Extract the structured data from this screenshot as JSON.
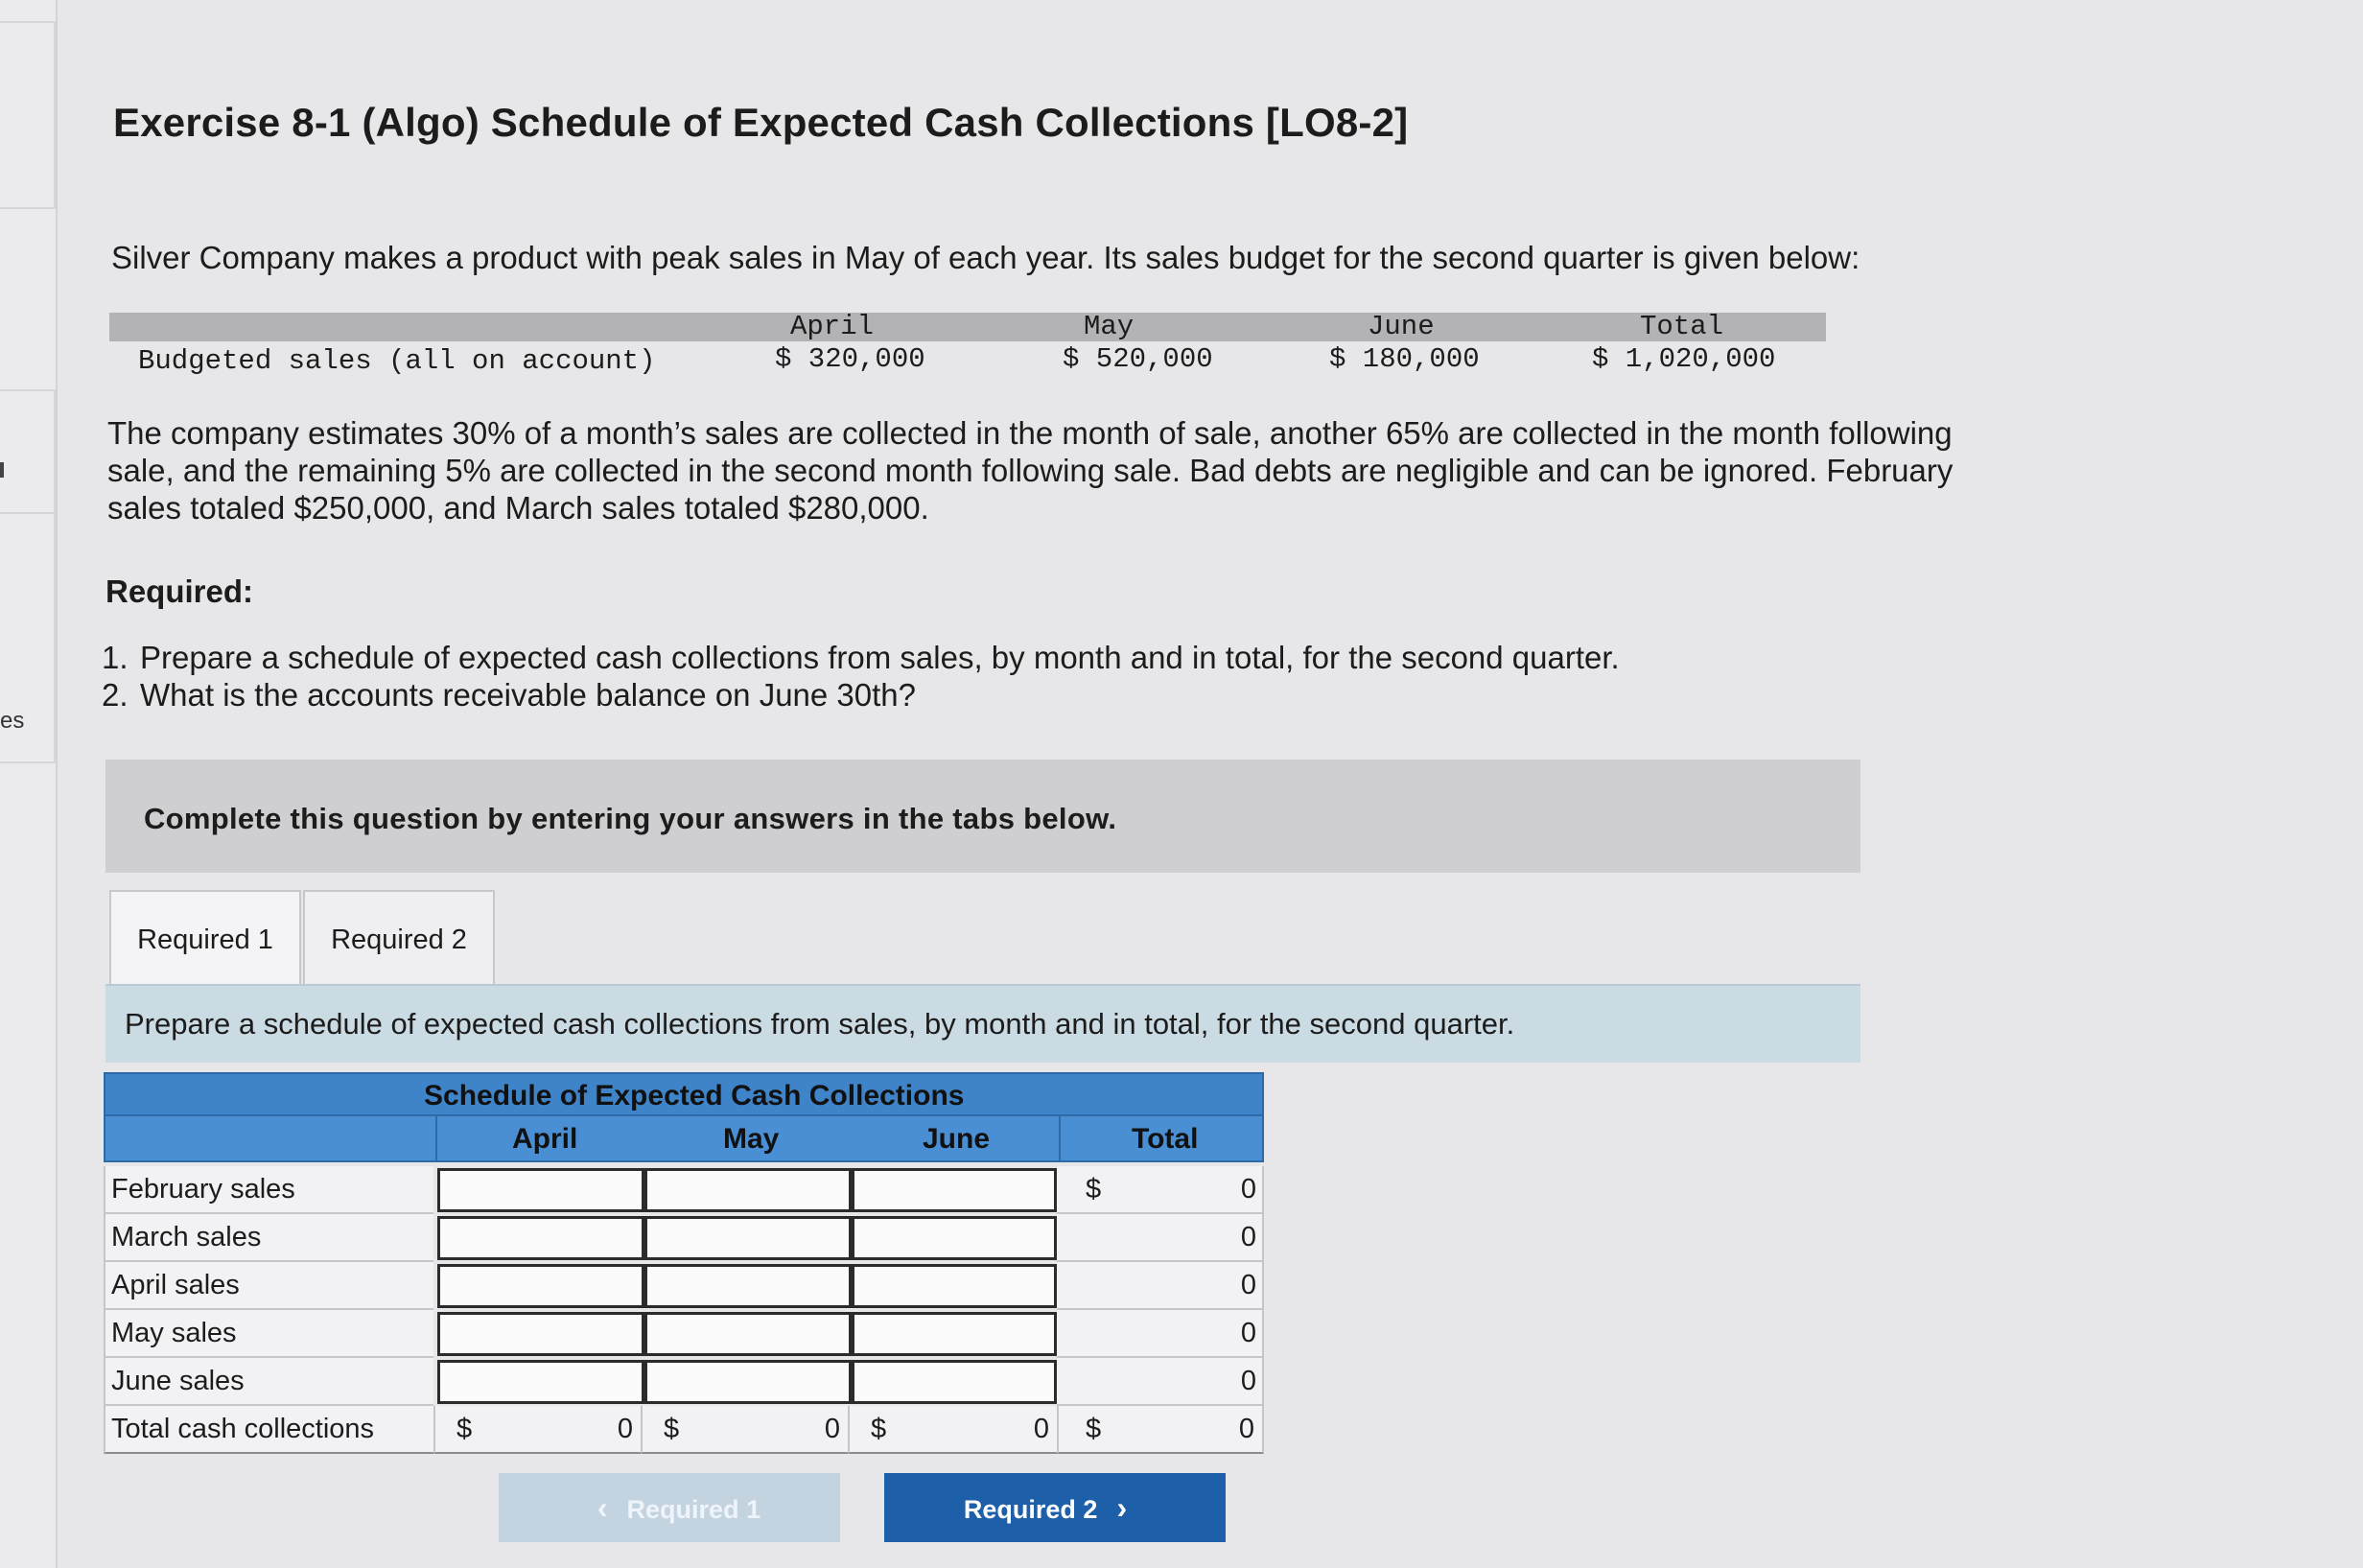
{
  "sidebar": {
    "partial_label": "es"
  },
  "exercise": {
    "title": "Exercise 8-1 (Algo) Schedule of Expected Cash Collections [LO8-2]",
    "intro": "Silver Company makes a product with peak sales in May of each year. Its sales budget for the second quarter is given below:",
    "budget": {
      "row_label": "Budgeted sales (all on account)",
      "columns": [
        "April",
        "May",
        "June",
        "Total"
      ],
      "values": [
        "$ 320,000",
        "$ 520,000",
        "$ 180,000",
        "$ 1,020,000"
      ]
    },
    "paragraph": "The company estimates 30% of a month’s sales are collected in the month of sale, another 65% are collected in the month following sale, and the remaining 5% are collected in the second month following sale. Bad debts are negligible and can be ignored. February sales totaled $250,000, and March sales totaled $280,000.",
    "required_heading": "Required:",
    "required_items": [
      {
        "num": "1.",
        "text": "Prepare a schedule of expected cash collections from sales, by month and in total, for the second quarter."
      },
      {
        "num": "2.",
        "text": "What is the accounts receivable balance on June 30th?"
      }
    ]
  },
  "instructions": "Complete this question by entering your answers in the tabs below.",
  "tabs": [
    {
      "label": "Required 1",
      "active": true
    },
    {
      "label": "Required 2",
      "active": false
    }
  ],
  "tab_prompt": "Prepare a schedule of expected cash collections from sales, by month and in total, for the second quarter.",
  "schedule": {
    "title": "Schedule of Expected Cash Collections",
    "columns": [
      "April",
      "May",
      "June",
      "Total"
    ],
    "rows": [
      {
        "label": "February sales",
        "total": "0",
        "show_dollar": true
      },
      {
        "label": "March sales",
        "total": "0",
        "show_dollar": false
      },
      {
        "label": "April sales",
        "total": "0",
        "show_dollar": false
      },
      {
        "label": "May sales",
        "total": "0",
        "show_dollar": false
      },
      {
        "label": "June sales",
        "total": "0",
        "show_dollar": false
      }
    ],
    "total_row": {
      "label": "Total cash collections",
      "currency": "$",
      "values": [
        "0",
        "0",
        "0",
        "0"
      ]
    }
  },
  "nav": {
    "prev_label": "Required 1",
    "next_label": "Required 2"
  },
  "colors": {
    "header_blue": "#4a8fd3",
    "next_button": "#1e5fa9",
    "prompt_bar": "#cbdbe4"
  }
}
